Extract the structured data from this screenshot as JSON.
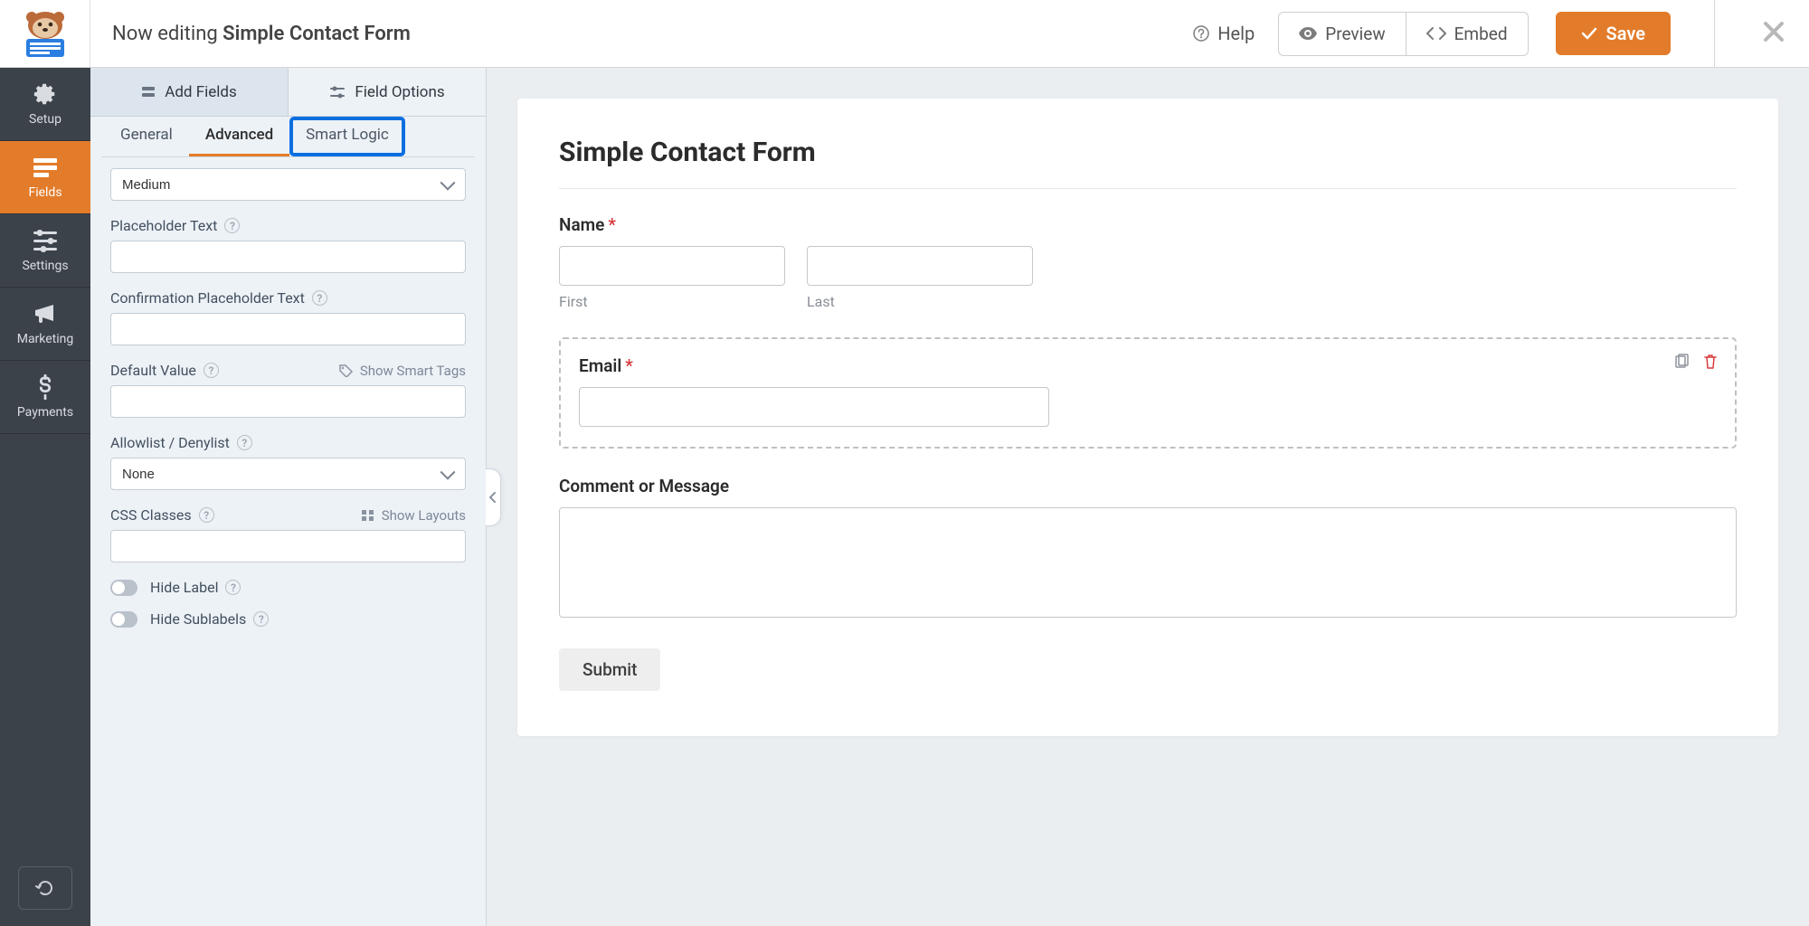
{
  "topbar": {
    "editing_prefix": "Now editing",
    "form_name": "Simple Contact Form",
    "help": "Help",
    "preview": "Preview",
    "embed": "Embed",
    "save": "Save"
  },
  "leftnav": {
    "items": [
      {
        "key": "setup",
        "label": "Setup"
      },
      {
        "key": "fields",
        "label": "Fields"
      },
      {
        "key": "settings",
        "label": "Settings"
      },
      {
        "key": "marketing",
        "label": "Marketing"
      },
      {
        "key": "payments",
        "label": "Payments"
      }
    ],
    "active": "fields"
  },
  "panel": {
    "major_tabs": {
      "add_fields": "Add Fields",
      "field_options": "Field Options",
      "active": "field_options"
    },
    "minor_tabs": {
      "general": "General",
      "advanced": "Advanced",
      "smart_logic": "Smart Logic",
      "active": "advanced",
      "highlighted": "smart_logic"
    },
    "fields": {
      "field_size": {
        "value": "Medium"
      },
      "placeholder": {
        "label": "Placeholder Text",
        "value": ""
      },
      "confirmation_placeholder": {
        "label": "Confirmation Placeholder Text",
        "value": ""
      },
      "default_value": {
        "label": "Default Value",
        "value": "",
        "smart_tags": "Show Smart Tags"
      },
      "allow_deny": {
        "label": "Allowlist / Denylist",
        "value": "None"
      },
      "css_classes": {
        "label": "CSS Classes",
        "value": "",
        "layouts": "Show Layouts"
      },
      "hide_label": {
        "label": "Hide Label"
      },
      "hide_sublabels": {
        "label": "Hide Sublabels"
      }
    }
  },
  "form": {
    "title": "Simple Contact Form",
    "name": {
      "label": "Name",
      "first_sub": "First",
      "last_sub": "Last"
    },
    "email": {
      "label": "Email"
    },
    "comment": {
      "label": "Comment or Message"
    },
    "submit": "Submit"
  }
}
